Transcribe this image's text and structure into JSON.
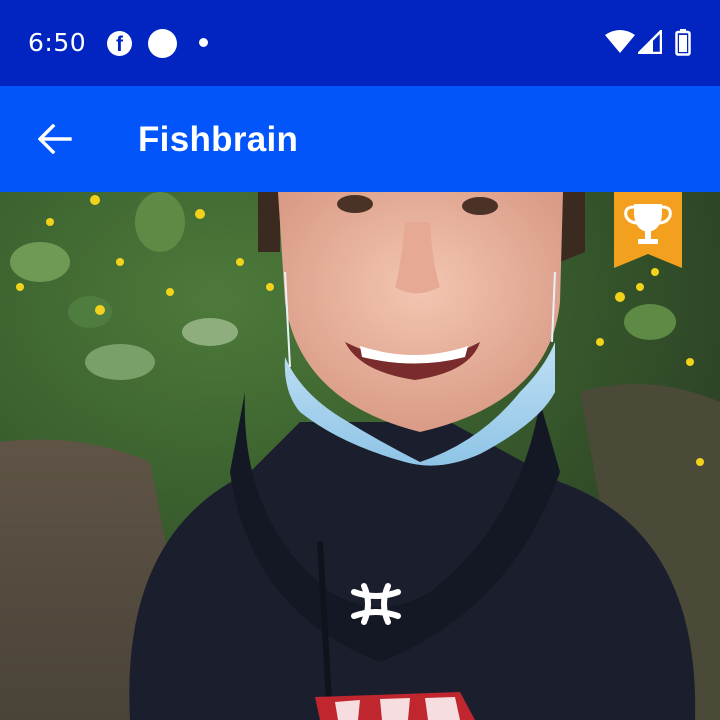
{
  "status_bar": {
    "time": "6:50",
    "icons": [
      "facebook-icon",
      "circle-notification-icon",
      "dot-icon",
      "wifi-icon",
      "signal-icon",
      "battery-icon"
    ]
  },
  "app_bar": {
    "title": "Fishbrain",
    "back_icon": "arrow-left-icon"
  },
  "photo": {
    "badge_icon": "trophy-icon",
    "hoodie_logo": "under-armour-logo"
  },
  "colors": {
    "status_bar": "#0225c2",
    "app_bar": "#0254fb",
    "badge": "#f2a01e"
  }
}
